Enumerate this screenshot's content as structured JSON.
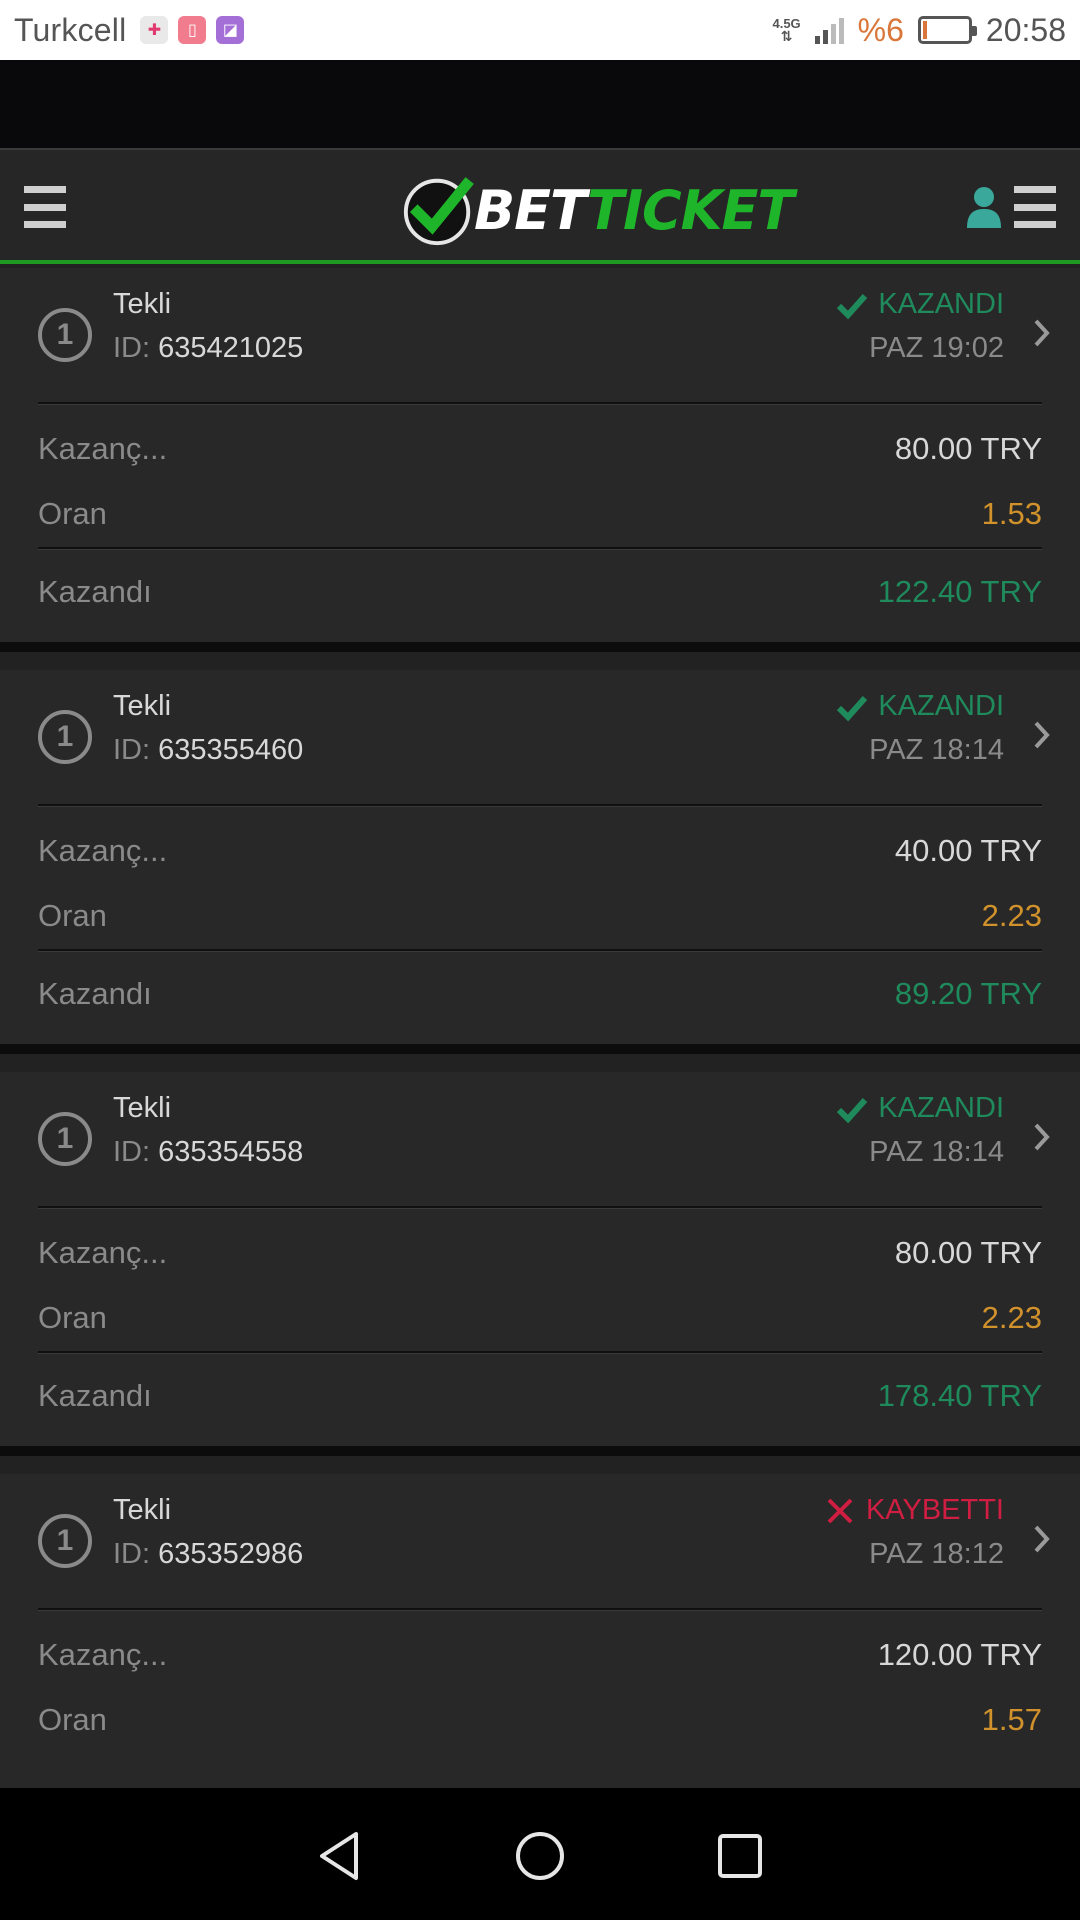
{
  "status_bar": {
    "carrier": "Turkcell",
    "network": "4.5G",
    "battery_percent": "%6",
    "time": "20:58",
    "notification_icons": [
      "app-icon",
      "alarm-icon",
      "image-icon"
    ]
  },
  "header": {
    "logo_bet": "BET",
    "logo_ticket": "TICKET",
    "left_menu_icon": "hamburger-icon",
    "user_icon": "user-icon",
    "right_menu_icon": "hamburger-icon"
  },
  "bets": [
    {
      "count": "1",
      "type": "Tekli",
      "id_label": "ID:",
      "id": "635421025",
      "status": "KAZANDI",
      "status_kind": "won",
      "date": "PAZ 19:02",
      "stake_label": "Kazanç...",
      "stake": "80.00 TRY",
      "odds_label": "Oran",
      "odds": "1.53",
      "result_label": "Kazandı",
      "result": "122.40 TRY"
    },
    {
      "count": "1",
      "type": "Tekli",
      "id_label": "ID:",
      "id": "635355460",
      "status": "KAZANDI",
      "status_kind": "won",
      "date": "PAZ 18:14",
      "stake_label": "Kazanç...",
      "stake": "40.00 TRY",
      "odds_label": "Oran",
      "odds": "2.23",
      "result_label": "Kazandı",
      "result": "89.20 TRY"
    },
    {
      "count": "1",
      "type": "Tekli",
      "id_label": "ID:",
      "id": "635354558",
      "status": "KAZANDI",
      "status_kind": "won",
      "date": "PAZ 18:14",
      "stake_label": "Kazanç...",
      "stake": "80.00 TRY",
      "odds_label": "Oran",
      "odds": "2.23",
      "result_label": "Kazandı",
      "result": "178.40 TRY"
    },
    {
      "count": "1",
      "type": "Tekli",
      "id_label": "ID:",
      "id": "635352986",
      "status": "KAYBETTI",
      "status_kind": "lost",
      "date": "PAZ 18:12",
      "stake_label": "Kazanç...",
      "stake": "120.00 TRY",
      "odds_label": "Oran",
      "odds": "1.57"
    }
  ],
  "colors": {
    "brand_green": "#1fb52a",
    "won": "#1f8a5c",
    "lost": "#d01e42",
    "odds": "#d1922c",
    "background": "#282828"
  },
  "nav_bar": {
    "back_icon": "back-triangle-icon",
    "home_icon": "home-circle-icon",
    "recents_icon": "recents-square-icon"
  }
}
